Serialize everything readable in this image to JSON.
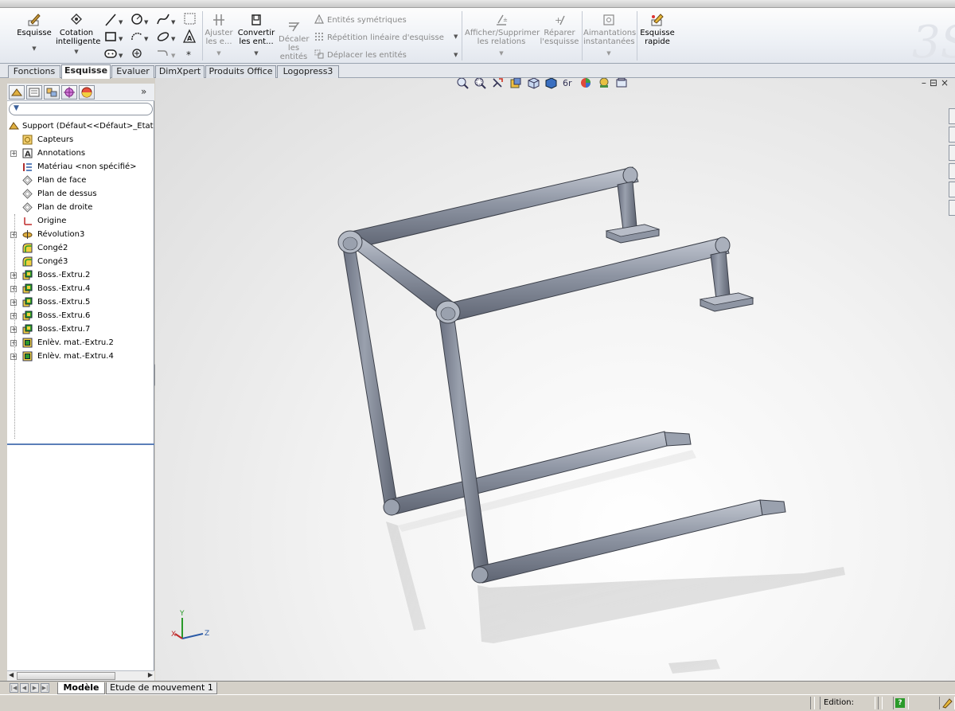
{
  "ribbon": {
    "sketch_label": "Esquisse",
    "smart_dim_label_1": "Cotation",
    "smart_dim_label_2": "intelligente",
    "trim_label_1": "Ajuster",
    "trim_label_2": "les e...",
    "convert_label_1": "Convertir",
    "convert_label_2": "les ent...",
    "offset_label_1": "Décaler",
    "offset_label_2": "les",
    "offset_label_3": "entités",
    "mirror_label": "Entités symétriques",
    "linear_pattern_label": "Répétition linéaire d'esquisse",
    "move_label": "Déplacer les entités",
    "relations_label_1": "Afficher/Supprimer",
    "relations_label_2": "les relations",
    "repair_label_1": "Réparer",
    "repair_label_2": "l'esquisse",
    "snaps_label_1": "Aimantations",
    "snaps_label_2": "instantanées",
    "rapid_label_1": "Esquisse",
    "rapid_label_2": "rapide"
  },
  "tabs": [
    {
      "label": "Fonctions"
    },
    {
      "label": "Esquisse"
    },
    {
      "label": "Evaluer"
    },
    {
      "label": "DimXpert"
    },
    {
      "label": "Produits Office"
    },
    {
      "label": "Logopress3"
    }
  ],
  "panel": {
    "more_glyph": "»",
    "filter_glyph": "▼"
  },
  "tree": {
    "root": "Support  (Défaut<<Défaut>_Etat c",
    "items": [
      {
        "label": "Capteurs",
        "icon": "sensor-icon",
        "expandable": false
      },
      {
        "label": "Annotations",
        "icon": "annotations-icon",
        "expandable": true
      },
      {
        "label": "Matériau <non spécifié>",
        "icon": "material-icon",
        "expandable": false
      },
      {
        "label": "Plan de face",
        "icon": "plane-icon",
        "expandable": false
      },
      {
        "label": "Plan de dessus",
        "icon": "plane-icon",
        "expandable": false
      },
      {
        "label": "Plan de droite",
        "icon": "plane-icon",
        "expandable": false
      },
      {
        "label": "Origine",
        "icon": "origin-icon",
        "expandable": false
      },
      {
        "label": "Révolution3",
        "icon": "revolve-icon",
        "expandable": true
      },
      {
        "label": "Congé2",
        "icon": "fillet-icon",
        "expandable": false
      },
      {
        "label": "Congé3",
        "icon": "fillet-icon",
        "expandable": false
      },
      {
        "label": "Boss.-Extru.2",
        "icon": "boss-extrude-icon",
        "expandable": true
      },
      {
        "label": "Boss.-Extru.4",
        "icon": "boss-extrude-icon",
        "expandable": true
      },
      {
        "label": "Boss.-Extru.5",
        "icon": "boss-extrude-icon",
        "expandable": true
      },
      {
        "label": "Boss.-Extru.6",
        "icon": "boss-extrude-icon",
        "expandable": true
      },
      {
        "label": "Boss.-Extru.7",
        "icon": "boss-extrude-icon",
        "expandable": true
      },
      {
        "label": "Enlèv. mat.-Extru.2",
        "icon": "cut-extrude-icon",
        "expandable": true
      },
      {
        "label": "Enlèv. mat.-Extru.4",
        "icon": "cut-extrude-icon",
        "expandable": true
      }
    ]
  },
  "triad": {
    "y_label": "Y",
    "x_label": "X",
    "z_label": "Z"
  },
  "bottom_tabs": [
    {
      "label": "Modèle"
    },
    {
      "label": "Etude de mouvement 1"
    }
  ],
  "status": {
    "mode": "Edition: Pièce",
    "help_glyph": "?"
  },
  "colors": {
    "tube": "#8e95a3",
    "accent": "#2a5aa6"
  }
}
